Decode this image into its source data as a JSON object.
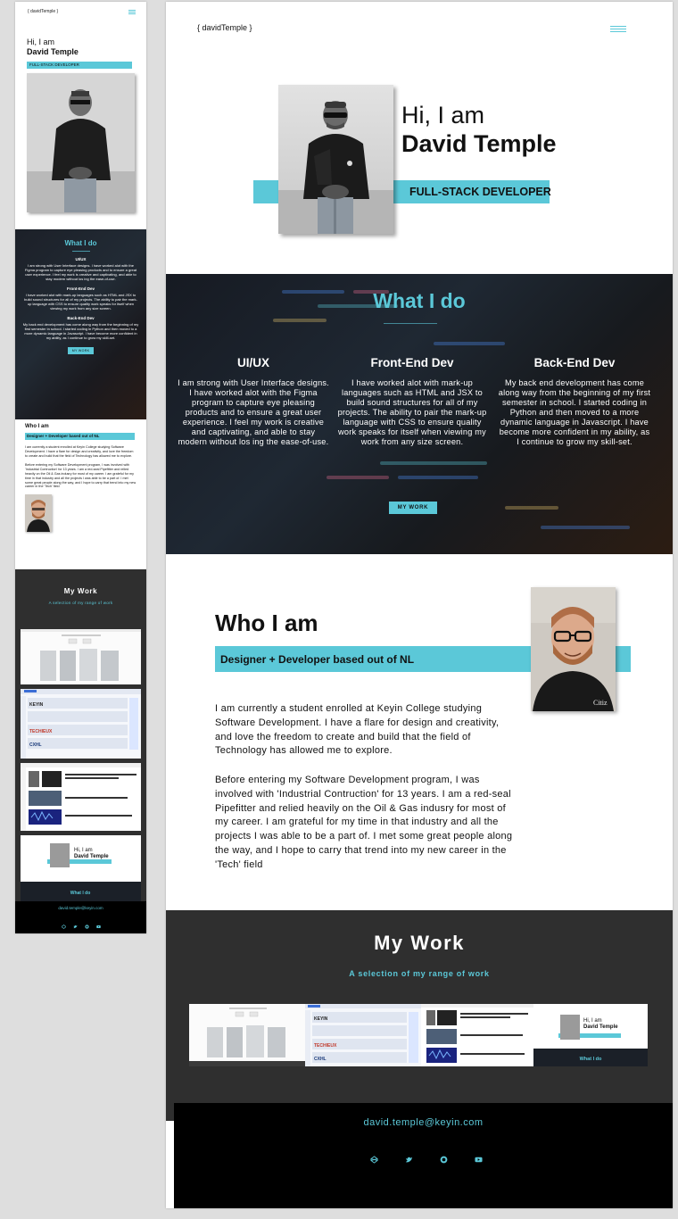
{
  "site": {
    "logo": "{ davidTemple }",
    "hero": {
      "hi": "Hi, I am",
      "name": "David Temple",
      "role": "FULL-STACK DEVELOPER"
    },
    "what_i_do": {
      "title": "What I do",
      "columns": [
        {
          "title": "UI/UX",
          "text": "I am strong with User Interface designs. I have worked alot with the Figma program to capture eye pleasing products and to ensure a great user experience. I feel my work is creative and captivating, and able to stay modern without los ing the ease-of-use."
        },
        {
          "title": "Front-End Dev",
          "text": "I have worked alot with mark-up languages such as HTML and JSX to build sound structures for all of my projects. The ability to pair the mark-up language with CSS to ensure quality work speaks for itself when viewing my work from any size screen."
        },
        {
          "title": "Back-End Dev",
          "text": "My back end development has come along way from the beginning of my first semester in school. I started coding in Python and then moved to a more dynamic language in Javascript. I have become more confident in my ability, as I continue to grow my skill-set."
        }
      ],
      "button": "MY WORK"
    },
    "who": {
      "title": "Who I am",
      "subtitle": "Designer + Developer based out of NL",
      "para1": "I am currently a student enrolled at Keyin College studying Software Development. I have a flare for design and creativity, and love the freedom to create and build that the field of Technology has allowed me to explore.",
      "para2": "Before entering my Software Development program, I was involved with 'Industrial Contruction' for 13 years. I am a red-seal Pipefitter and relied heavily on the Oil & Gas indusry for most of my career. I am grateful for my time in that industry and all the projects I was able to be a part of. I met some great people along the way, and I hope to carry that trend into my new career in the 'Tech' field"
    },
    "work": {
      "title": "My Work",
      "subtitle": "A selection of my range of work"
    },
    "footer": {
      "email": "david.temple@keyin.com"
    },
    "social_icons": [
      "codepen-icon",
      "twitter-icon",
      "github-icon",
      "youtube-icon"
    ]
  },
  "colors": {
    "accent": "#5bc8d8",
    "dark": "#2f2f2f",
    "footer": "#000000"
  }
}
